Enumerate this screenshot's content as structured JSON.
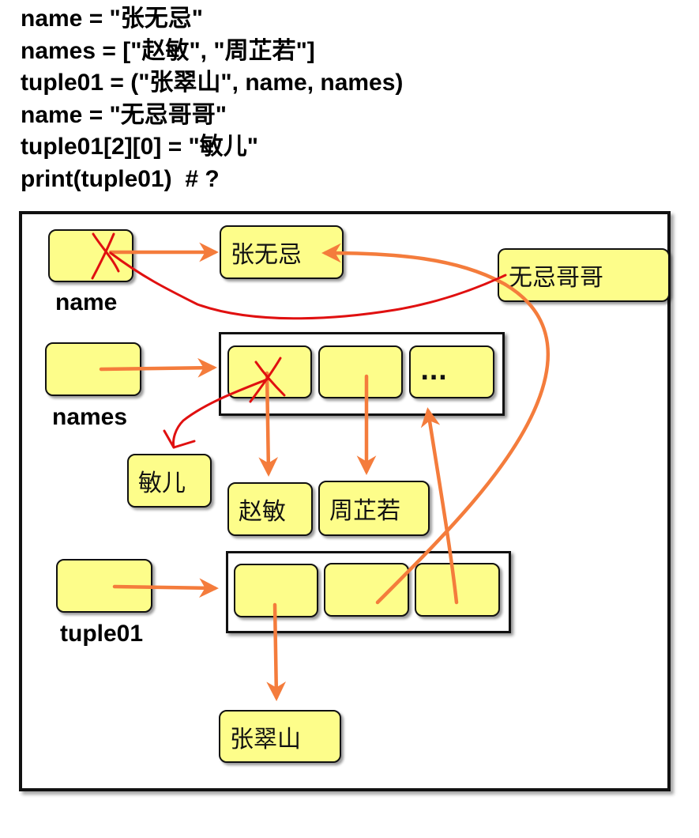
{
  "code_lines": [
    "name = \"张无忌\"",
    "names = [\"赵敏\", \"周芷若\"]",
    "tuple01 = (\"张翠山\", name, names)",
    "name = \"无忌哥哥\"",
    "tuple01[2][0] = \"敏儿\"",
    "print(tuple01)  # ?"
  ],
  "variables": {
    "name": "name",
    "names": "names",
    "tuple01": "tuple01"
  },
  "values": {
    "zhang_wuji": "张无忌",
    "wuji_gege": "无忌哥哥",
    "zhao_min": "赵敏",
    "zhou_zhiruo": "周芷若",
    "min_er": "敏儿",
    "zhang_cuishan": "张翠山",
    "ellipsis": "..."
  },
  "colors": {
    "cell_fill": "#fdfd8a",
    "arrow_orange": "#f47c3c",
    "arrow_red": "#e01010",
    "border": "#111111"
  }
}
